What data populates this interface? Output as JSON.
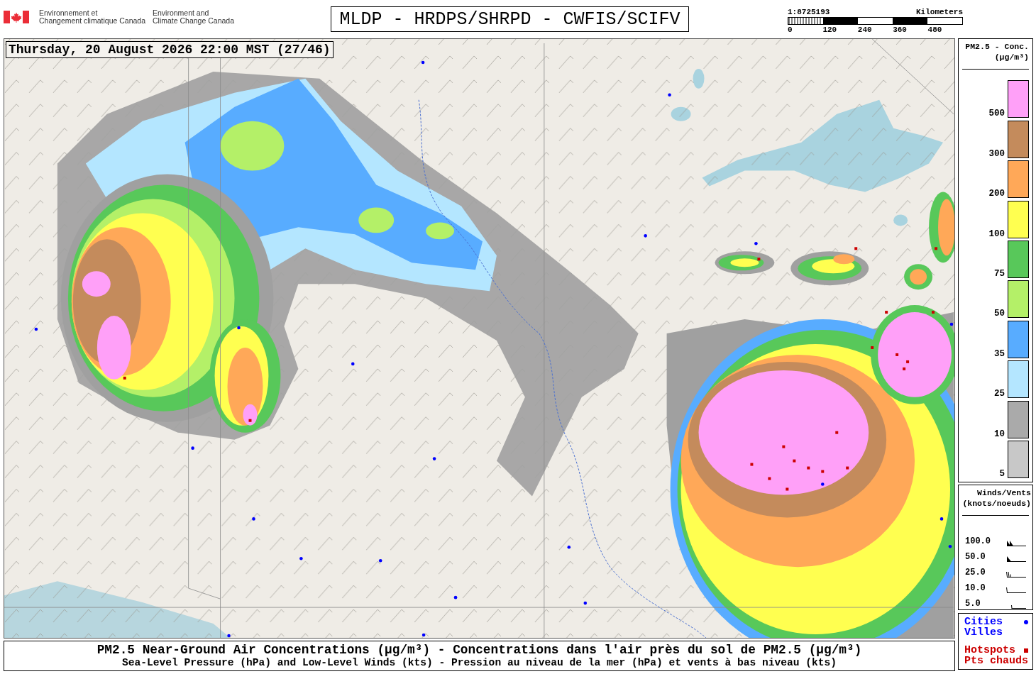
{
  "header": {
    "department_fr": [
      "Environnement et",
      "Changement climatique Canada"
    ],
    "department_en": [
      "Environment and",
      "Climate Change Canada"
    ],
    "title": "MLDP - HRDPS/SHRPD - CWFIS/SCIFV",
    "scale": {
      "ratio": "1:8725193",
      "unit": "Kilometers",
      "ticks": [
        "0",
        "120",
        "240",
        "360",
        "480"
      ]
    }
  },
  "map": {
    "timestamp": "Thursday, 20 August 2026 22:00 MST (27/46)"
  },
  "concentration_legend": {
    "title": "PM2.5 - Conc.",
    "unit": "(µg/m³)",
    "bins": [
      {
        "label": "500",
        "color": "#ffa0f8"
      },
      {
        "label": "300",
        "color": "#c48b5c"
      },
      {
        "label": "200",
        "color": "#ffa858"
      },
      {
        "label": "100",
        "color": "#ffff50"
      },
      {
        "label": "75",
        "color": "#58c85a"
      },
      {
        "label": "50",
        "color": "#b4f068"
      },
      {
        "label": "35",
        "color": "#58acff"
      },
      {
        "label": "25",
        "color": "#b4e6ff"
      },
      {
        "label": "10",
        "color": "#aaaaaa"
      },
      {
        "label": "5",
        "color": "#c8c8c8"
      }
    ]
  },
  "wind_legend": {
    "title": "Winds/Vents",
    "unit": "(knots/noeuds)",
    "rows": [
      {
        "label": "100.0",
        "kind": "pennants"
      },
      {
        "label": "50.0",
        "kind": "pennant"
      },
      {
        "label": "25.0",
        "kind": "barbs"
      },
      {
        "label": "10.0",
        "kind": "barb"
      },
      {
        "label": "5.0",
        "kind": "halfbarb"
      }
    ]
  },
  "symbol_legend": [
    {
      "labels": [
        "Cities",
        "Villes"
      ],
      "kind": "dot",
      "color": "#0000ff"
    },
    {
      "labels": [
        "Hotspots",
        "Pts chauds"
      ],
      "kind": "square",
      "color": "#cc0000"
    }
  ],
  "caption": {
    "line_1": "PM2.5 Near-Ground Air Concentrations (µg/m³) - Concentrations dans l'air près du sol de PM2.5 (µg/m³)",
    "line_2": "Sea-Level Pressure (hPa) and Low-Level Winds (kts) - Pression au niveau de la mer (hPa) et vents à bas niveau (kts)"
  }
}
